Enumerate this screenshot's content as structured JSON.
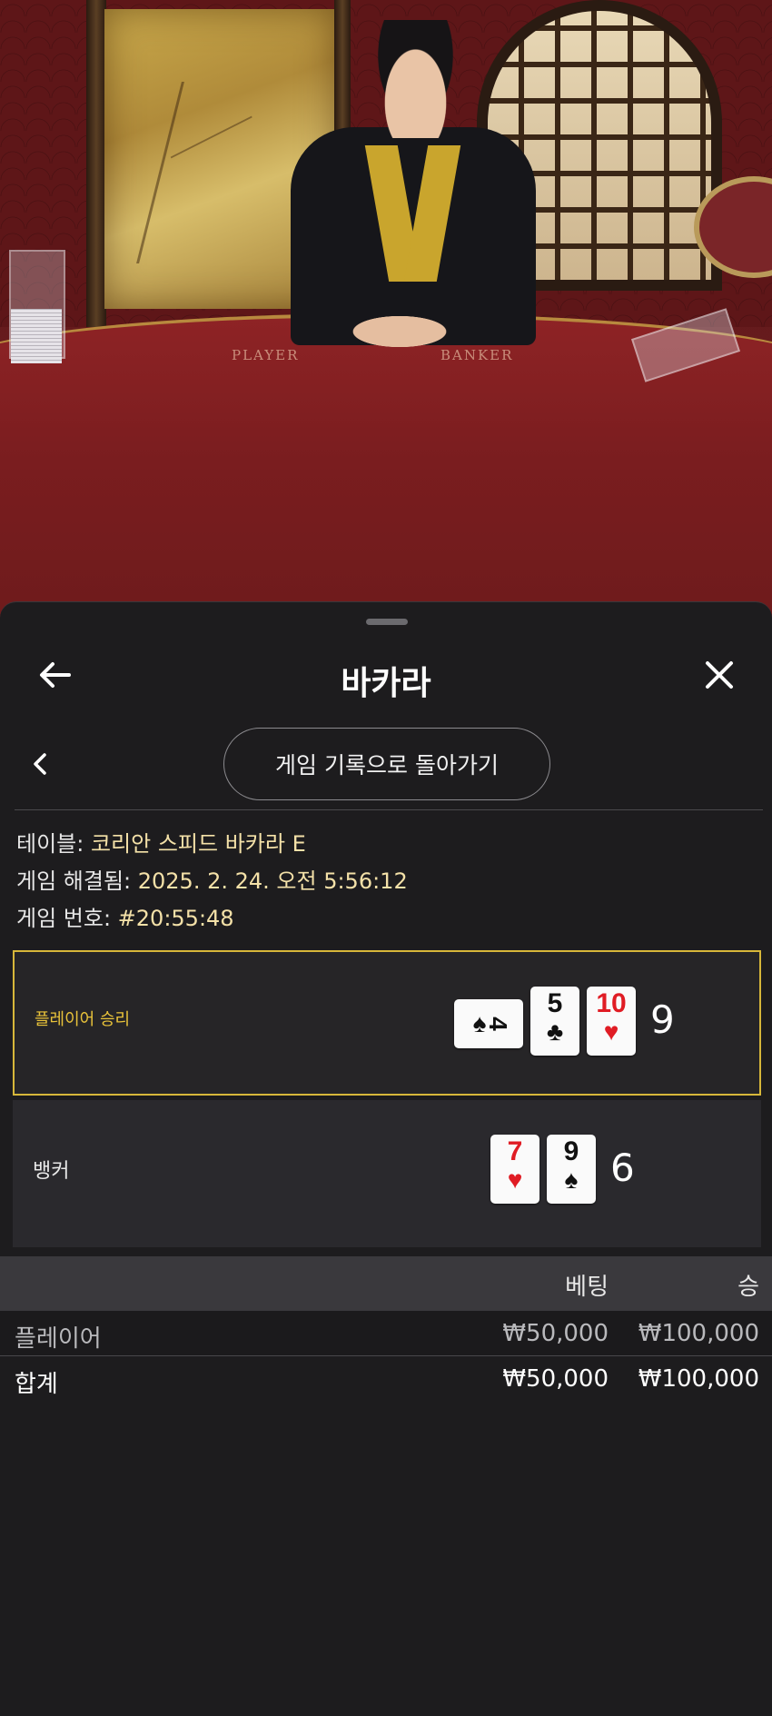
{
  "video": {
    "felt_labels": {
      "player": "PLAYER",
      "banker": "BANKER"
    }
  },
  "sheet": {
    "title": "바카라",
    "back_icon": "arrow-left-icon",
    "close_icon": "close-icon",
    "prev_icon": "chevron-left-icon",
    "back_to_history_label": "게임 기록으로 돌아가기"
  },
  "info": {
    "table_label": "테이블: ",
    "table_value": "코리안 스피드 바카라 E",
    "resolved_label": "게임 해결됨: ",
    "resolved_value": "2025. 2. 24. 오전 5:56:12",
    "number_label": "게임 번호: ",
    "number_value": "#20:55:48"
  },
  "hands": {
    "player": {
      "label": "플레이어 승리",
      "score": "9",
      "cards": [
        {
          "rank": "4",
          "suit": "♠",
          "color": "black",
          "sideways": true
        },
        {
          "rank": "5",
          "suit": "♣",
          "color": "black",
          "sideways": false
        },
        {
          "rank": "10",
          "suit": "♥",
          "color": "red",
          "sideways": false
        }
      ]
    },
    "banker": {
      "label": "뱅커",
      "score": "6",
      "cards": [
        {
          "rank": "7",
          "suit": "♥",
          "color": "red",
          "sideways": false
        },
        {
          "rank": "9",
          "suit": "♠",
          "color": "black",
          "sideways": false
        }
      ]
    }
  },
  "bets_table": {
    "headers": {
      "bet": "베팅",
      "win": "승"
    },
    "rows": [
      {
        "name": "플레이어",
        "bet": "₩50,000",
        "win": "₩100,000"
      }
    ],
    "total": {
      "name": "합계",
      "bet": "₩50,000",
      "win": "₩100,000"
    }
  },
  "colors": {
    "accent": "#d7b73a",
    "sheet_bg": "#1d1c1e",
    "card_red": "#e01c24"
  }
}
